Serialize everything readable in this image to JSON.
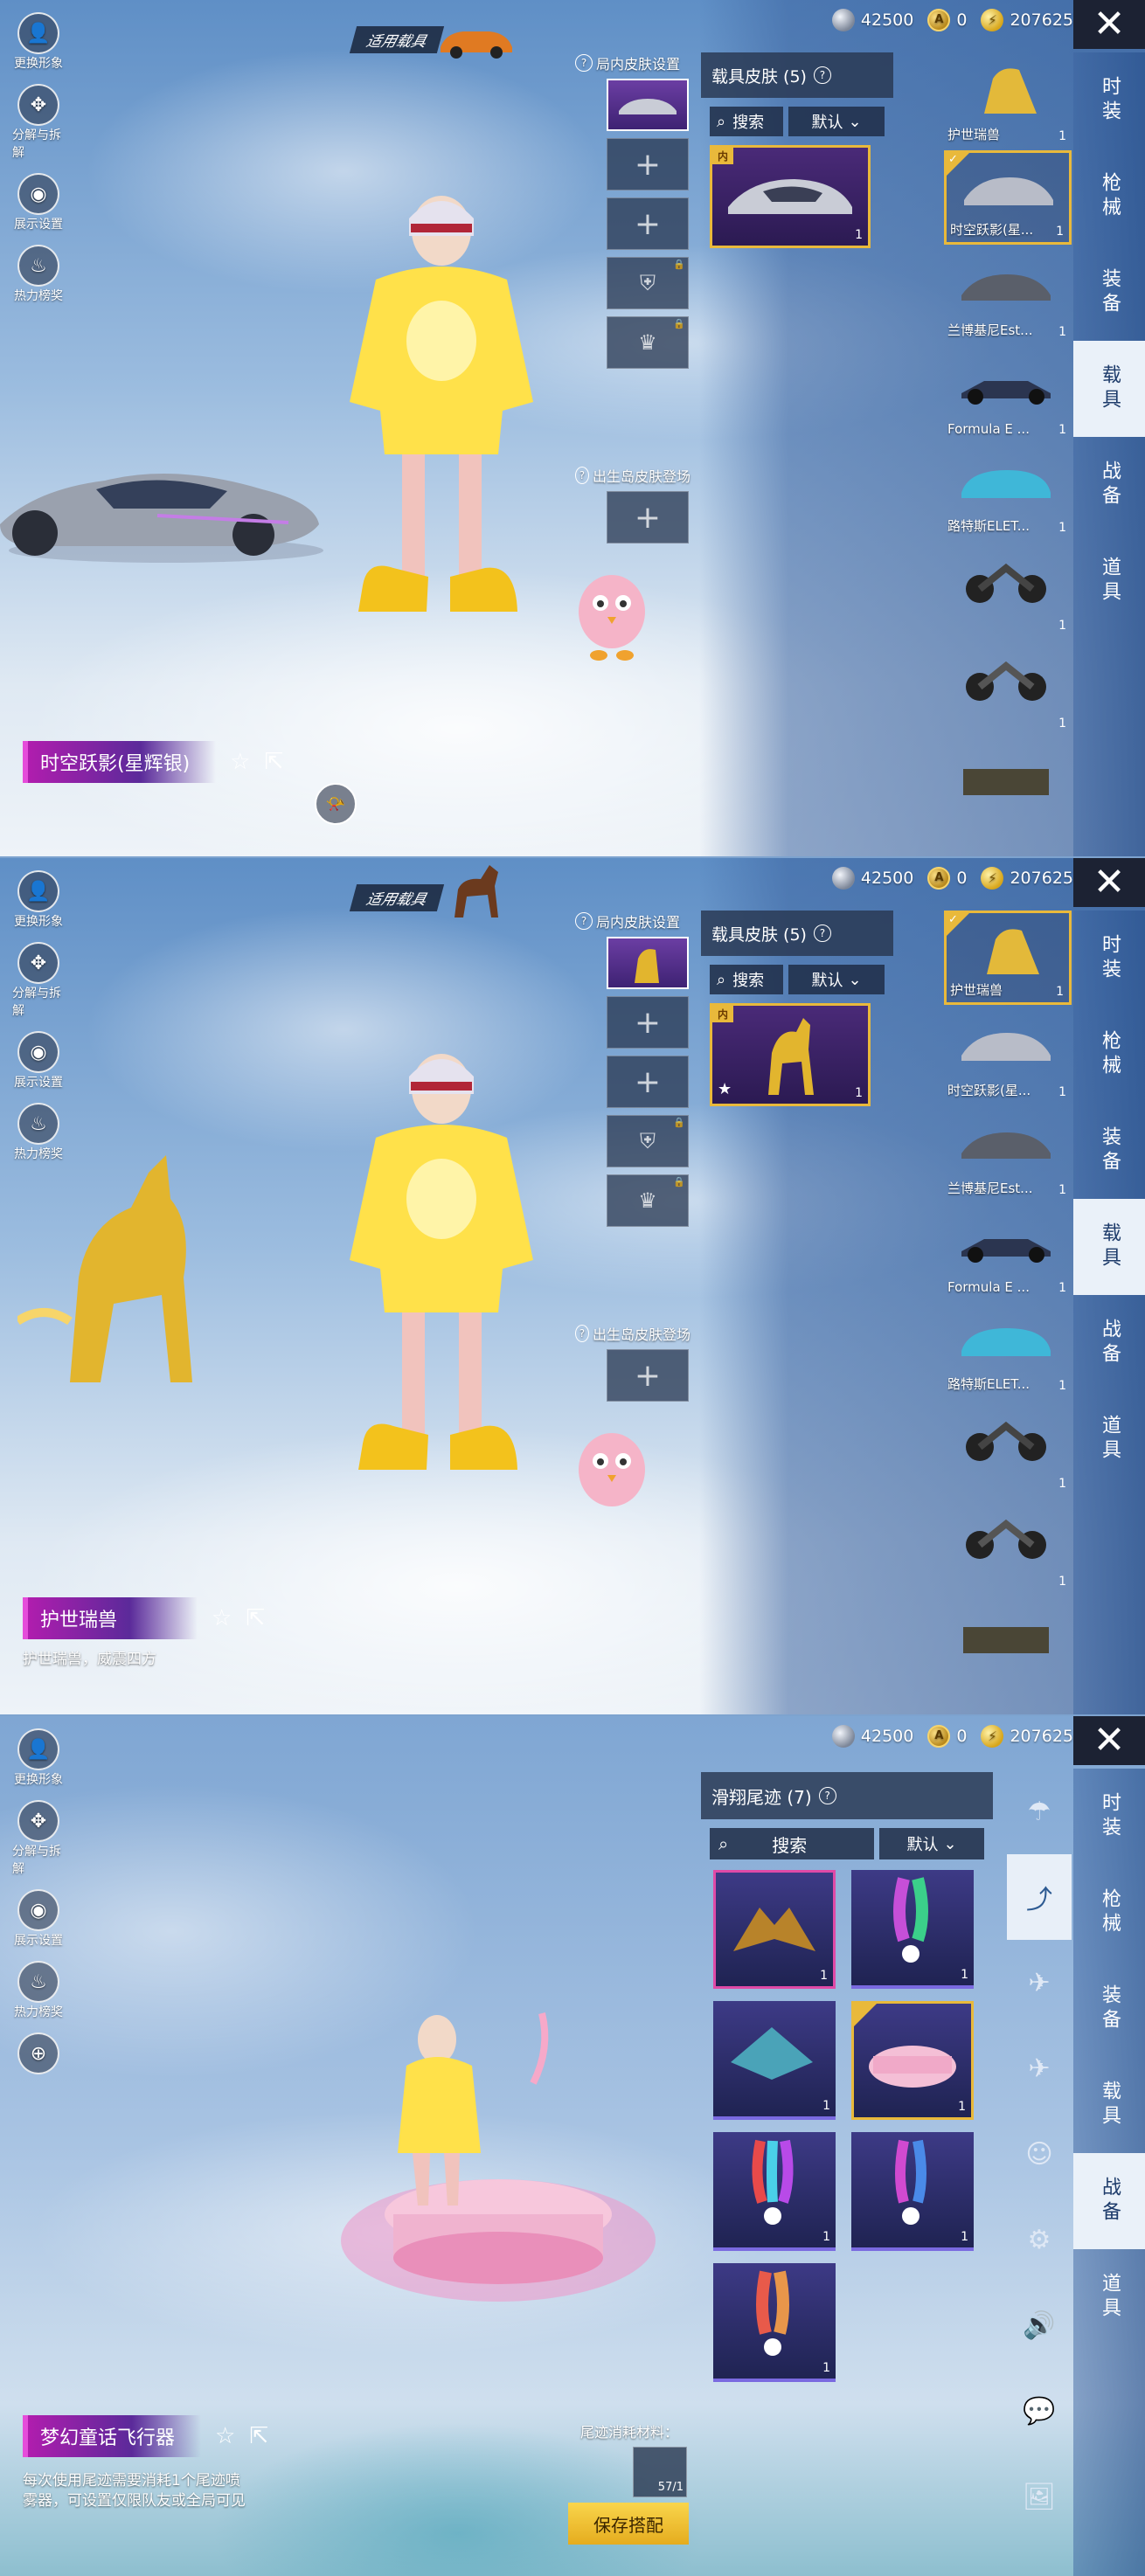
{
  "currency": {
    "silver": "42500",
    "ag": "0",
    "uc": "207625"
  },
  "left_tools": [
    "更换形象",
    "分解与拆解",
    "展示设置",
    "热力榜奖"
  ],
  "tabs_vehicle": [
    "时装",
    "枪械",
    "装备",
    "载具",
    "战备",
    "道具"
  ],
  "tabs_trail": [
    "时装",
    "枪械",
    "装备",
    "载具",
    "战备",
    "道具"
  ],
  "panel1": {
    "badge": "适用载具",
    "slot_title": "局内皮肤设置",
    "birth_title": "出生岛皮肤登场",
    "skin_header": "载具皮肤 (5)",
    "search": "搜索",
    "sort": "默认",
    "card_tag": "内",
    "card_count": "1",
    "name": "时空跃影(星辉银)",
    "items": [
      {
        "label": "护世瑞兽",
        "count": "1"
      },
      {
        "label": "时空跃影(星...",
        "count": "1"
      },
      {
        "label": "兰博基尼Est...",
        "count": "1"
      },
      {
        "label": "Formula E ...",
        "count": "1"
      },
      {
        "label": "路特斯ELET...",
        "count": "1"
      },
      {
        "label": "",
        "count": "1"
      },
      {
        "label": "",
        "count": "1"
      },
      {
        "label": "",
        "count": ""
      }
    ]
  },
  "panel2": {
    "badge": "适用载具",
    "slot_title": "局内皮肤设置",
    "birth_title": "出生岛皮肤登场",
    "skin_header": "载具皮肤 (5)",
    "search": "搜索",
    "sort": "默认",
    "card_tag": "内",
    "card_count": "1",
    "name": "护世瑞兽",
    "desc": "护世瑞兽，威震四方",
    "items": [
      {
        "label": "护世瑞兽",
        "count": "1"
      },
      {
        "label": "时空跃影(星...",
        "count": "1"
      },
      {
        "label": "兰博基尼Est...",
        "count": "1"
      },
      {
        "label": "Formula E ...",
        "count": "1"
      },
      {
        "label": "路特斯ELET...",
        "count": "1"
      },
      {
        "label": "",
        "count": "1"
      },
      {
        "label": "",
        "count": "1"
      },
      {
        "label": "",
        "count": ""
      }
    ]
  },
  "panel3": {
    "trail_header": "滑翔尾迹 (7)",
    "search": "搜索",
    "sort": "默认",
    "cards": [
      {
        "count": "1"
      },
      {
        "count": "1"
      },
      {
        "count": "1"
      },
      {
        "count": "1"
      },
      {
        "count": "1"
      },
      {
        "count": "1"
      },
      {
        "count": "1"
      }
    ],
    "name": "梦幻童话飞行器",
    "desc": "每次使用尾迹需要消耗1个尾迹喷雾器，可设置仅限队友或全局可见",
    "consume_label": "尾迹消耗材料：",
    "consume_count": "57/1",
    "save": "保存搭配"
  }
}
